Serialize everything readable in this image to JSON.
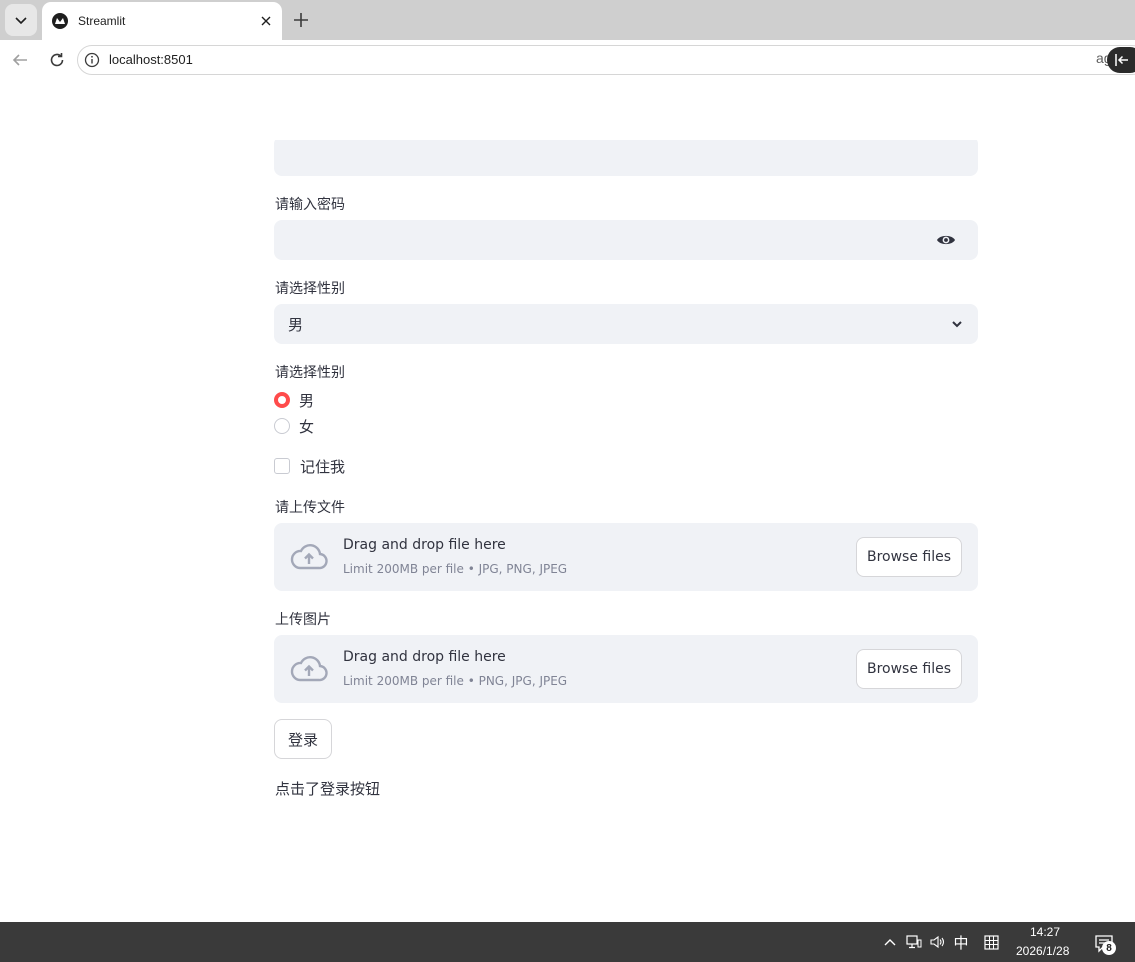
{
  "browser": {
    "tab_title": "Streamlit",
    "url": "localhost:8501",
    "omnibox_tail": "ag"
  },
  "form": {
    "password_label": "请输入密码",
    "select_label": "请选择性别",
    "select_value": "男",
    "radio_label": "请选择性别",
    "radio_options": [
      {
        "label": "男",
        "selected": true
      },
      {
        "label": "女",
        "selected": false
      }
    ],
    "checkbox_label": "记住我",
    "checkbox_checked": false,
    "uploader1": {
      "label": "请上传文件",
      "title": "Drag and drop file here",
      "limit": "Limit 200MB per file • JPG, PNG, JPEG",
      "button": "Browse files"
    },
    "uploader2": {
      "label": "上传图片",
      "title": "Drag and drop file here",
      "limit": "Limit 200MB per file • PNG, JPG, JPEG",
      "button": "Browse files"
    },
    "login_button": "登录",
    "result_text": "点击了登录按钮"
  },
  "taskbar": {
    "ime": "中",
    "time": "14:27",
    "date": "2026/1/28",
    "notifications": "8"
  },
  "colors": {
    "accent": "#ff4b4b",
    "input_bg": "#f0f2f6",
    "text": "#31333f",
    "muted": "#808495",
    "taskbar": "#3a3a3a"
  }
}
